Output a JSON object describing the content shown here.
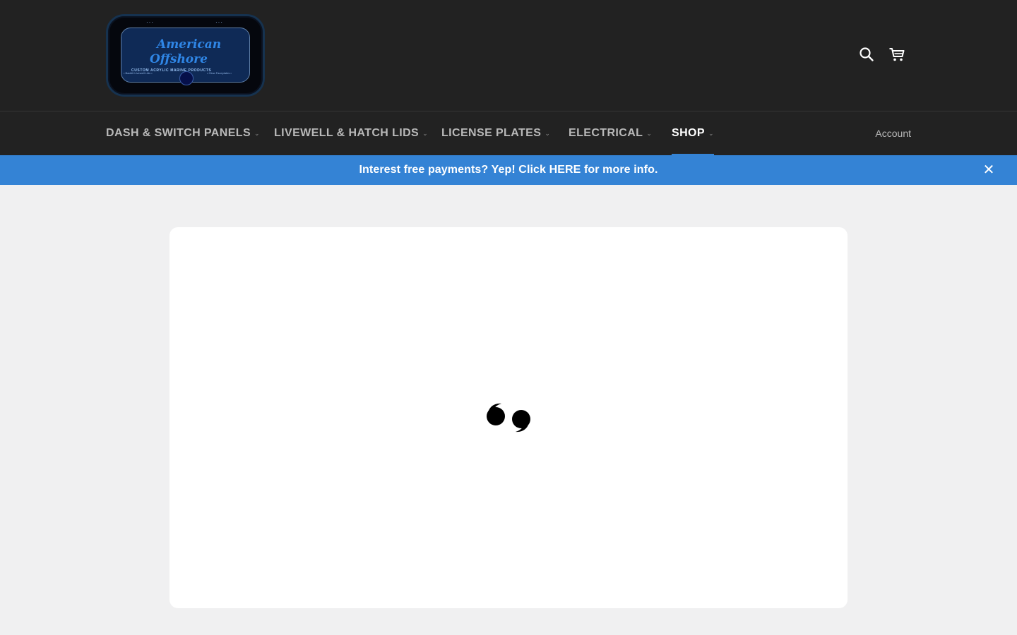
{
  "header": {
    "logo": {
      "line1": "American",
      "line2": "Offshore",
      "subtitle": "CUSTOM ACRYLIC MARINE PRODUCTS",
      "fine_left": "• Backlit Livewell Lids •",
      "fine_right": "• Glow Faceplates •"
    },
    "search_icon": "search-icon",
    "cart_icon": "cart-icon"
  },
  "nav": {
    "items": [
      {
        "label": "DASH & SWITCH PANELS",
        "active": false
      },
      {
        "label": "LIVEWELL & HATCH LIDS",
        "active": false
      },
      {
        "label": "LICENSE PLATES",
        "active": false
      },
      {
        "label": "ELECTRICAL",
        "active": false
      },
      {
        "label": "SHOP",
        "active": true
      }
    ],
    "account_label": "Account",
    "chevron": "⌄"
  },
  "announcement": {
    "text": "Interest free payments? Yep! Click HERE for more info.",
    "close_symbol": "✕"
  },
  "main": {
    "quote_icon": "quote-icon"
  },
  "colors": {
    "header_bg": "#222222",
    "accent": "#3483d5",
    "page_bg": "#f0f0f1"
  }
}
